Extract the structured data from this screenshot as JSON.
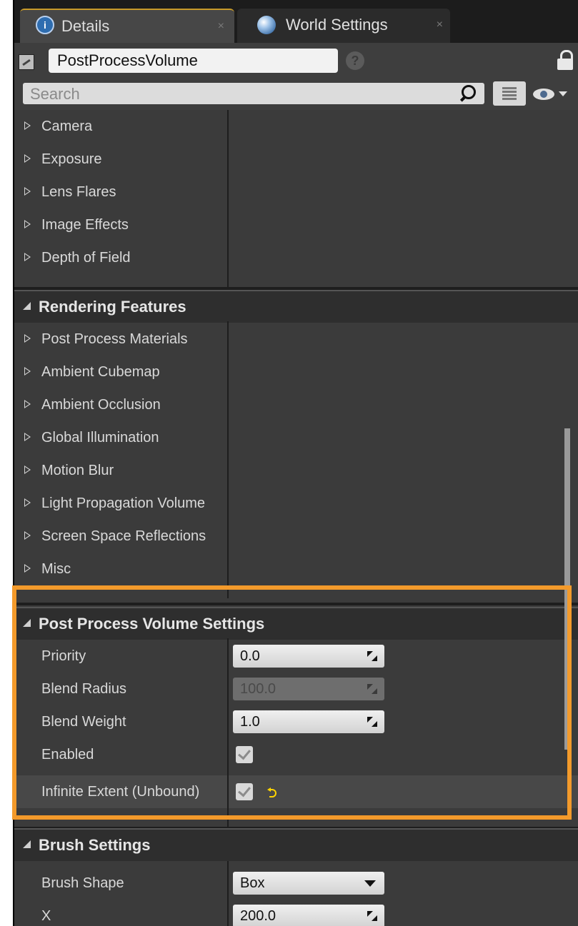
{
  "tabs": [
    {
      "label": "Details",
      "icon": "details-info-icon"
    },
    {
      "label": "World Settings",
      "icon": "world-globe-icon"
    }
  ],
  "tab_close_glyph": "×",
  "actor": {
    "name": "PostProcessVolume",
    "help_glyph": "?"
  },
  "search": {
    "placeholder": "Search"
  },
  "groups": {
    "lens_items": [
      "Camera",
      "Exposure",
      "Lens Flares",
      "Image Effects",
      "Depth of Field"
    ],
    "rendering_features": {
      "title": "Rendering Features",
      "items": [
        "Post Process Materials",
        "Ambient Cubemap",
        "Ambient Occlusion",
        "Global Illumination",
        "Motion Blur",
        "Light Propagation Volume",
        "Screen Space Reflections",
        "Misc"
      ]
    },
    "ppv_settings": {
      "title": "Post Process Volume Settings",
      "priority": {
        "label": "Priority",
        "value": "0.0"
      },
      "blend_radius": {
        "label": "Blend Radius",
        "value": "100.0"
      },
      "blend_weight": {
        "label": "Blend Weight",
        "value": "1.0"
      },
      "enabled": {
        "label": "Enabled",
        "checked": true
      },
      "infinite_extent": {
        "label": "Infinite Extent (Unbound)",
        "checked": true
      }
    },
    "brush_settings": {
      "title": "Brush Settings",
      "brush_shape": {
        "label": "Brush Shape",
        "value": "Box"
      },
      "x": {
        "label": "X",
        "value": "200.0"
      }
    }
  },
  "colors": {
    "highlight_frame": "#f39a2b",
    "reset_arrow": "#ffd400",
    "active_tab_accent": "#c89b2a"
  }
}
